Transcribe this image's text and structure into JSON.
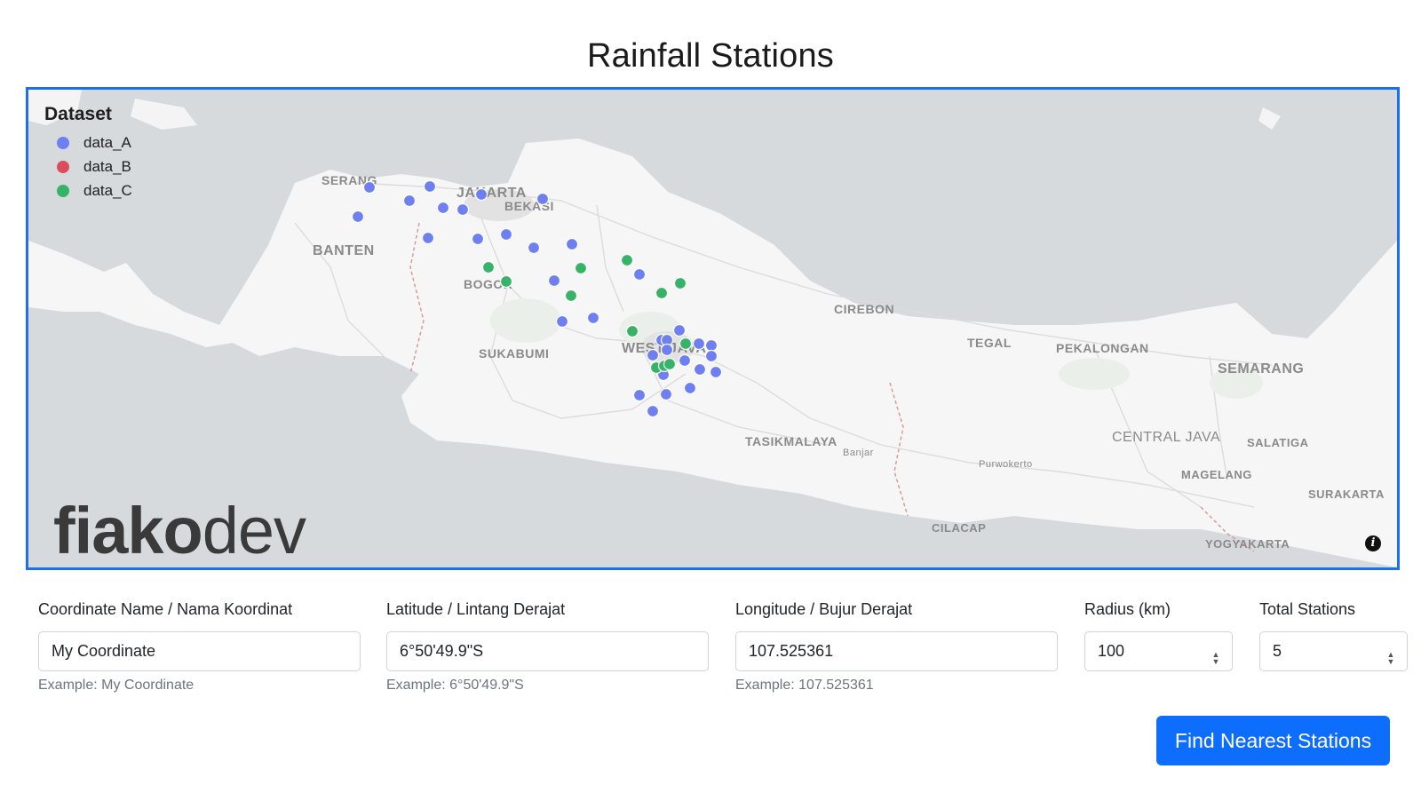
{
  "page": {
    "title": "Rainfall Stations"
  },
  "map": {
    "legend": {
      "title": "Dataset",
      "items": [
        {
          "label": "data_A",
          "color": "#6e7ff2"
        },
        {
          "label": "data_B",
          "color": "#dc4c5a"
        },
        {
          "label": "data_C",
          "color": "#36b366"
        }
      ]
    },
    "brand": {
      "part1": "fiako",
      "part2": "dev"
    },
    "info_icon": "info-icon",
    "place_labels": [
      "SERANG",
      "JAKARTA",
      "BEKASI",
      "BANTEN",
      "BOGOR",
      "SUKABUMI",
      "WEST JAVA",
      "CIREBON",
      "TEGAL",
      "PEKALONGAN",
      "SEMARANG",
      "TASIKMALAYA",
      "Banjar",
      "Purwokerto",
      "CENTRAL JAVA",
      "SALATIGA",
      "MAGELANG",
      "SURAKARTA",
      "CILACAP",
      "YOGYAKARTA"
    ]
  },
  "form": {
    "name": {
      "label": "Coordinate Name / Nama Koordinat",
      "value": "My Coordinate",
      "help": "Example: My Coordinate"
    },
    "latitude": {
      "label": "Latitude / Lintang Derajat",
      "value": "6°50'49.9\"S",
      "help": "Example: 6°50'49.9\"S"
    },
    "longitude": {
      "label": "Longitude / Bujur Derajat",
      "value": "107.525361",
      "help": "Example: 107.525361"
    },
    "radius": {
      "label": "Radius (km)",
      "value": "100"
    },
    "total": {
      "label": "Total Stations",
      "value": "5"
    },
    "submit_label": "Find Nearest Stations"
  }
}
